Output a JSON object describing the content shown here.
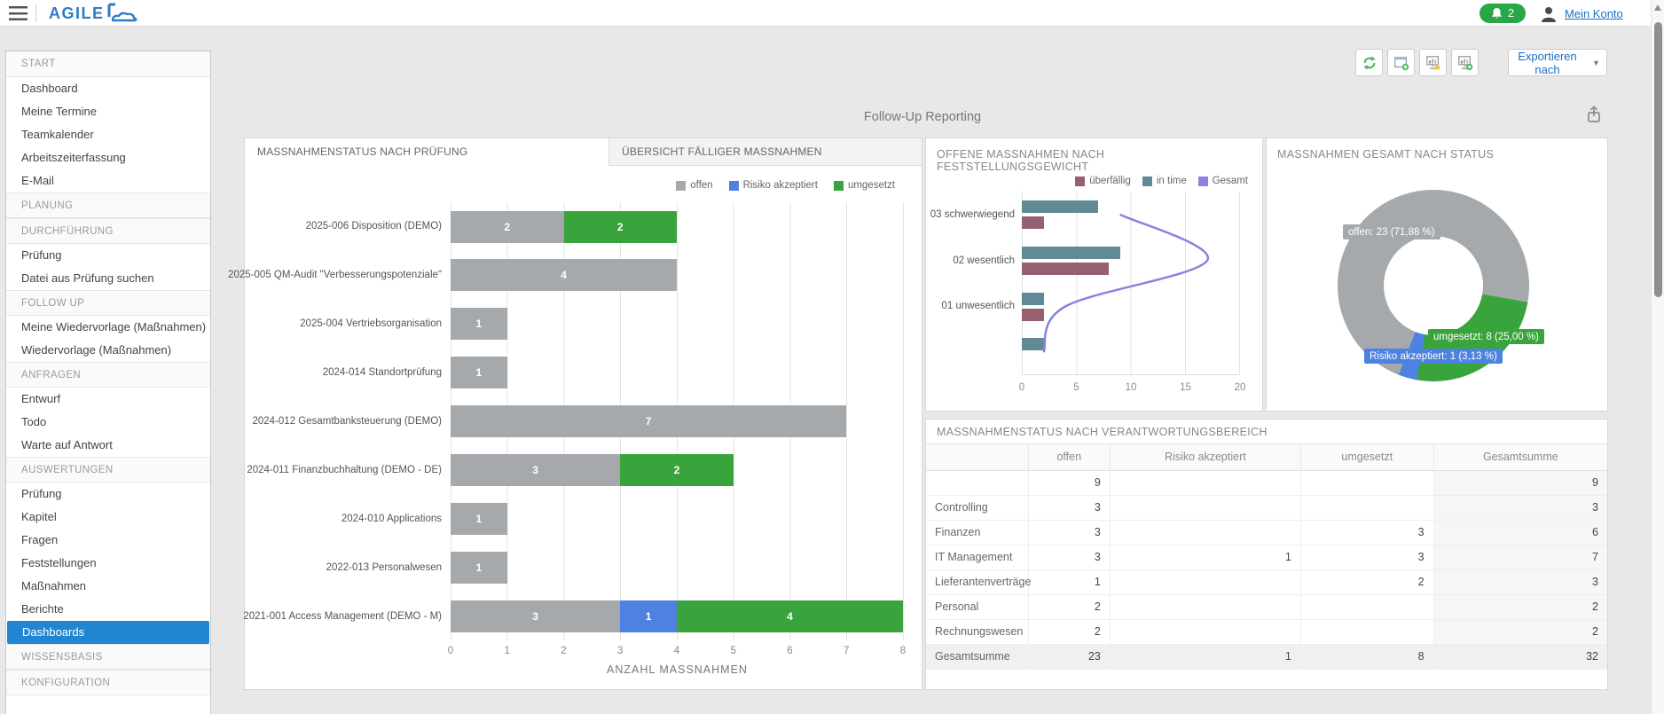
{
  "header": {
    "logo_text": "AGILE",
    "notification_count": "2",
    "account_link": "Mein Konto"
  },
  "toolbar": {
    "export_label": "Exportieren nach",
    "buttons": [
      "refresh",
      "add-dashboard",
      "dashboard-favorite",
      "dashboard-run"
    ]
  },
  "page": {
    "title": "Follow-Up Reporting"
  },
  "sidebar": {
    "selected_item": "Dashboards",
    "sections": [
      {
        "label": "START",
        "items": [
          "Dashboard",
          "Meine Termine",
          "Teamkalender",
          "Arbeitszeiterfassung",
          "E-Mail"
        ]
      },
      {
        "label": "PLANUNG",
        "items": []
      },
      {
        "label": "DURCHFÜHRUNG",
        "items": [
          "Prüfung",
          "Datei aus Prüfung suchen"
        ]
      },
      {
        "label": "FOLLOW UP",
        "items": [
          "Meine Wiedervorlage (Maßnahmen)",
          "Wiedervorlage (Maßnahmen)"
        ]
      },
      {
        "label": "ANFRAGEN",
        "items": [
          "Entwurf",
          "Todo",
          "Warte auf Antwort"
        ]
      },
      {
        "label": "AUSWERTUNGEN",
        "items": [
          "Prüfung",
          "Kapitel",
          "Fragen",
          "Feststellungen",
          "Maßnahmen",
          "Berichte",
          "Dashboards"
        ]
      },
      {
        "label": "WISSENSBASIS",
        "items": []
      },
      {
        "label": "KONFIGURATION",
        "items": []
      }
    ]
  },
  "card1": {
    "tabs": [
      "MASSNAHMENSTATUS NACH PRÜFUNG",
      "ÜBERSICHT FÄLLIGER MASSNAHMEN"
    ]
  },
  "chart_data": [
    {
      "name": "MASSNAHMENSTATUS NACH PRÜFUNG",
      "type": "bar",
      "orientation": "horizontal",
      "stacked": true,
      "categories": [
        "2025-006 Disposition (DEMO)",
        "2025-005 QM-Audit \"Verbesserungspotenziale\"",
        "2025-004 Vertriebsorganisation",
        "2024-014 Standortprüfung",
        "2024-012 Gesamtbanksteuerung (DEMO)",
        "2024-011 Finanzbuchhaltung (DEMO - DE)",
        "2024-010 Applications",
        "2022-013 Personalwesen",
        "2021-001 Access Management (DEMO - M)"
      ],
      "series": [
        {
          "name": "offen",
          "color": "#a6a9ac",
          "values": [
            2,
            4,
            1,
            1,
            7,
            3,
            1,
            1,
            3
          ]
        },
        {
          "name": "Risiko akzeptiert",
          "color": "#4e82e0",
          "values": [
            0,
            0,
            0,
            0,
            0,
            0,
            0,
            0,
            1
          ]
        },
        {
          "name": "umgesetzt",
          "color": "#3aa43c",
          "values": [
            2,
            0,
            0,
            0,
            0,
            2,
            0,
            0,
            4
          ]
        }
      ],
      "xlabel": "ANZAHL MASSNAHMEN",
      "xlim": [
        0,
        8
      ],
      "xticks": [
        0,
        1,
        2,
        3,
        4,
        5,
        6,
        7,
        8
      ],
      "legend_position": "top-right",
      "grid": true
    },
    {
      "name": "OFFENE MASSNAHMEN NACH FESTSTELLUNGSGEWICHT",
      "type": "bar+line",
      "orientation": "horizontal",
      "categories": [
        "03 schwerwiegend",
        "02 wesentlich",
        "01 unwesentlich",
        ""
      ],
      "series": [
        {
          "name": "überfällig",
          "color": "#96606e",
          "kind": "bar",
          "values": [
            2,
            8,
            2,
            0
          ]
        },
        {
          "name": "in time",
          "color": "#5f8a96",
          "kind": "bar",
          "values": [
            7,
            9,
            2,
            2
          ]
        },
        {
          "name": "Gesamt",
          "color": "#8c82dd",
          "kind": "line",
          "values": [
            9,
            17,
            4,
            2
          ]
        }
      ],
      "bar_order": [
        "in time",
        "überfällig"
      ],
      "xlim": [
        0,
        20
      ],
      "xticks": [
        0,
        5,
        10,
        15,
        20
      ],
      "legend_position": "top-right",
      "grid": true
    },
    {
      "name": "MASSNAHMEN GESAMT NACH STATUS",
      "type": "pie",
      "donut": true,
      "total": 32,
      "slices": [
        {
          "label": "offen",
          "value": 23,
          "pct": "71,88 %",
          "color": "#a6a9ac",
          "display": "offen: 23 (71,88 %)"
        },
        {
          "label": "umgesetzt",
          "value": 8,
          "pct": "25,00 %",
          "color": "#3aa43c",
          "display": "umgesetzt: 8 (25,00 %)"
        },
        {
          "label": "Risiko akzeptiert",
          "value": 1,
          "pct": "3,13 %",
          "color": "#4e82e0",
          "display": "Risiko akzeptiert: 1 (3,13 %)"
        }
      ]
    },
    {
      "name": "MASSNAHMENSTATUS NACH VERANTWORTUNGSBEREICH",
      "type": "table",
      "columns": [
        "",
        "offen",
        "Risiko akzeptiert",
        "umgesetzt",
        "Gesamtsumme"
      ],
      "rows": [
        [
          "",
          "9",
          "",
          "",
          "9"
        ],
        [
          "Controlling",
          "3",
          "",
          "",
          "3"
        ],
        [
          "Finanzen",
          "3",
          "",
          "3",
          "6"
        ],
        [
          "IT Management",
          "3",
          "1",
          "3",
          "7"
        ],
        [
          "Lieferantenverträge",
          "1",
          "",
          "2",
          "3"
        ],
        [
          "Personal",
          "2",
          "",
          "",
          "2"
        ],
        [
          "Rechnungswesen",
          "2",
          "",
          "",
          "2"
        ],
        [
          "Gesamtsumme",
          "23",
          "1",
          "8",
          "32"
        ]
      ]
    }
  ]
}
